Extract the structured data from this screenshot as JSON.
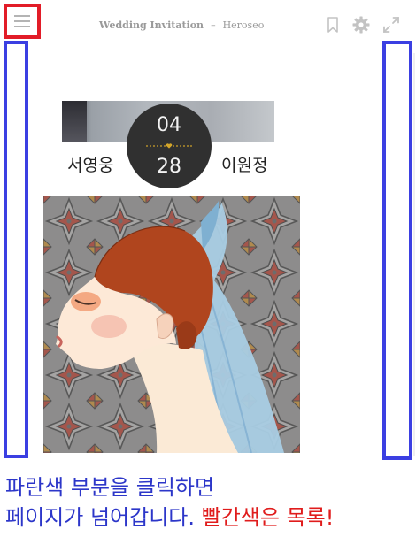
{
  "header": {
    "app_title": "Wedding Invitation",
    "separator": "–",
    "author": "Heroseo"
  },
  "toolbar": {
    "icons": [
      "menu-icon",
      "bookmark-icon",
      "gear-icon",
      "expand-icon"
    ]
  },
  "invitation": {
    "groom": "서영웅",
    "bride": "이원정",
    "month": "04",
    "day": "28"
  },
  "caption": {
    "line1": "파란색 부분을 클릭하면",
    "line2_blue": "페이지가 넘어갑니다.",
    "line2_red": "빨간색은 목록!"
  },
  "colors": {
    "highlight_menu": "#e21c28",
    "highlight_nav": "#3b3fe2",
    "caption_blue": "#2c36c9",
    "caption_red": "#e01c1c",
    "date_circle": "#303030",
    "heart": "#d4a62a"
  }
}
